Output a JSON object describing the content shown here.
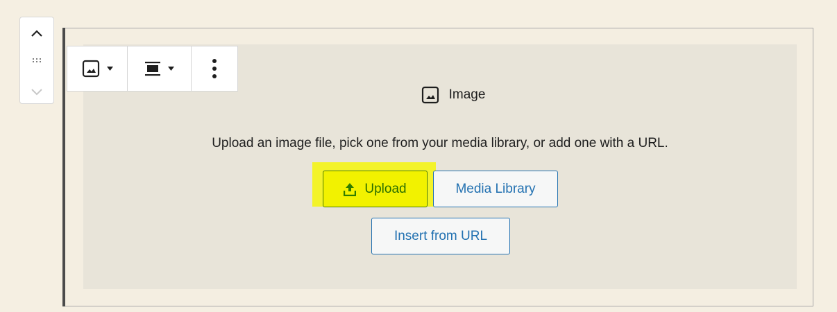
{
  "block_title": "Image",
  "instructions": "Upload an image file, pick one from your media library, or add one with a URL.",
  "buttons": {
    "upload": "Upload",
    "media_library": "Media Library",
    "insert_url": "Insert from URL"
  },
  "icons": {
    "mover_up": "chevron-up-icon",
    "drag_handle": "drag-handle-icon",
    "mover_down": "chevron-down-icon",
    "block_type": "image-icon",
    "align": "align-center-icon",
    "more": "more-vertical-icon",
    "upload": "upload-icon"
  },
  "colors": {
    "page_bg": "#f5efe2",
    "placeholder_bg": "#e8e4d9",
    "link_blue": "#2271b1",
    "highlight_yellow": "#f3f32a",
    "upload_green": "#2a6e00"
  }
}
